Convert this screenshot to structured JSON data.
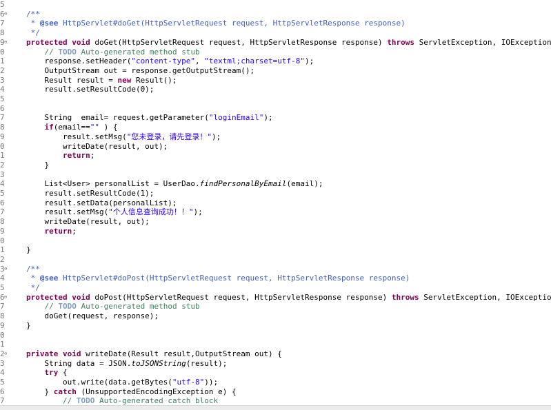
{
  "editor": {
    "gutter_digits": [
      "5",
      "6",
      "7",
      "8",
      "9",
      "0",
      "1",
      "2",
      "3",
      "4",
      "5",
      "6",
      "7",
      "8",
      "9",
      "0",
      "1",
      "2",
      "3",
      "4",
      "5",
      "6",
      "7",
      "8",
      "9",
      "0",
      "1",
      "2",
      "3",
      "4",
      "5",
      "6",
      "7",
      "8",
      "9",
      "0",
      "1",
      "2",
      "3",
      "4",
      "5",
      "6",
      "7"
    ],
    "lines": [
      {
        "num": "5",
        "fold": "",
        "code": ""
      },
      {
        "num": "6",
        "fold": "⊖",
        "code": "/**"
      },
      {
        "num": "7",
        "fold": "",
        "code": " * @see HttpServlet#doGet(HttpServletRequest request, HttpServletResponse response)"
      },
      {
        "num": "8",
        "fold": "",
        "code": " */"
      },
      {
        "num": "9",
        "fold": "⊖",
        "code": "protected void doGet(HttpServletRequest request, HttpServletResponse response) throws ServletException, IOException {"
      },
      {
        "num": "0",
        "fold": "",
        "code": "    // TODO Auto-generated method stub"
      },
      {
        "num": "1",
        "fold": "",
        "code": "    response.setHeader(\"content-type\", \"textml;charset=utf-8\");"
      },
      {
        "num": "2",
        "fold": "",
        "code": "    OutputStream out = response.getOutputStream();"
      },
      {
        "num": "3",
        "fold": "",
        "code": "    Result result = new Result();"
      },
      {
        "num": "4",
        "fold": "",
        "code": "    result.setResultCode(0);"
      },
      {
        "num": "5",
        "fold": "",
        "code": ""
      },
      {
        "num": "6",
        "fold": "",
        "code": ""
      },
      {
        "num": "7",
        "fold": "",
        "code": "    String  email= request.getParameter(\"loginEmail\");"
      },
      {
        "num": "8",
        "fold": "",
        "code": "    if(email==\"\" ) {"
      },
      {
        "num": "9",
        "fold": "",
        "code": "        result.setMsg(\"您未登录，请先登录！\");"
      },
      {
        "num": "0",
        "fold": "",
        "code": "        writeDate(result, out);"
      },
      {
        "num": "1",
        "fold": "",
        "code": "        return;"
      },
      {
        "num": "2",
        "fold": "",
        "code": "    }"
      },
      {
        "num": "3",
        "fold": "",
        "code": ""
      },
      {
        "num": "4",
        "fold": "",
        "code": "    List<User> personalList = UserDao.findPersonalByEmail(email);"
      },
      {
        "num": "5",
        "fold": "",
        "code": "    result.setResultCode(1);"
      },
      {
        "num": "6",
        "fold": "",
        "code": "    result.setData(personalList);"
      },
      {
        "num": "7",
        "fold": "",
        "code": "    result.setMsg(\"个人信息查询成功！！\");"
      },
      {
        "num": "8",
        "fold": "",
        "code": "    writeDate(result, out);"
      },
      {
        "num": "9",
        "fold": "",
        "code": "    return;"
      },
      {
        "num": "0",
        "fold": "",
        "code": ""
      },
      {
        "num": "1",
        "fold": "",
        "code": "}"
      },
      {
        "num": "2",
        "fold": "",
        "code": ""
      },
      {
        "num": "3",
        "fold": "⊖",
        "code": "/**"
      },
      {
        "num": "4",
        "fold": "",
        "code": " * @see HttpServlet#doPost(HttpServletRequest request, HttpServletResponse response)"
      },
      {
        "num": "5",
        "fold": "",
        "code": " */"
      },
      {
        "num": "6",
        "fold": "⊖",
        "code": "protected void doPost(HttpServletRequest request, HttpServletResponse response) throws ServletException, IOException {"
      },
      {
        "num": "7",
        "fold": "",
        "code": "    // TODO Auto-generated method stub"
      },
      {
        "num": "8",
        "fold": "",
        "code": "    doGet(request, response);"
      },
      {
        "num": "9",
        "fold": "",
        "code": "}"
      },
      {
        "num": "0",
        "fold": "",
        "code": ""
      },
      {
        "num": "1",
        "fold": "",
        "code": ""
      },
      {
        "num": "2",
        "fold": "⊖",
        "code": "private void writeDate(Result result,OutputStream out) {"
      },
      {
        "num": "3",
        "fold": "",
        "code": "    String data = JSON.toJSONString(result);"
      },
      {
        "num": "4",
        "fold": "",
        "code": "    try {"
      },
      {
        "num": "5",
        "fold": "",
        "code": "        out.write(data.getBytes(\"utf-8\"));"
      },
      {
        "num": "6",
        "fold": "",
        "code": "    } catch (UnsupportedEncodingException e) {"
      },
      {
        "num": "7",
        "fold": "",
        "code": "        // TODO Auto-generated catch block"
      }
    ]
  },
  "colors": {
    "keyword": "#7f0055",
    "string": "#2a00ff",
    "comment": "#3f7f5f",
    "javadoc": "#3f5fbf",
    "todo": "#7f9fbf",
    "line_number": "#787878"
  }
}
